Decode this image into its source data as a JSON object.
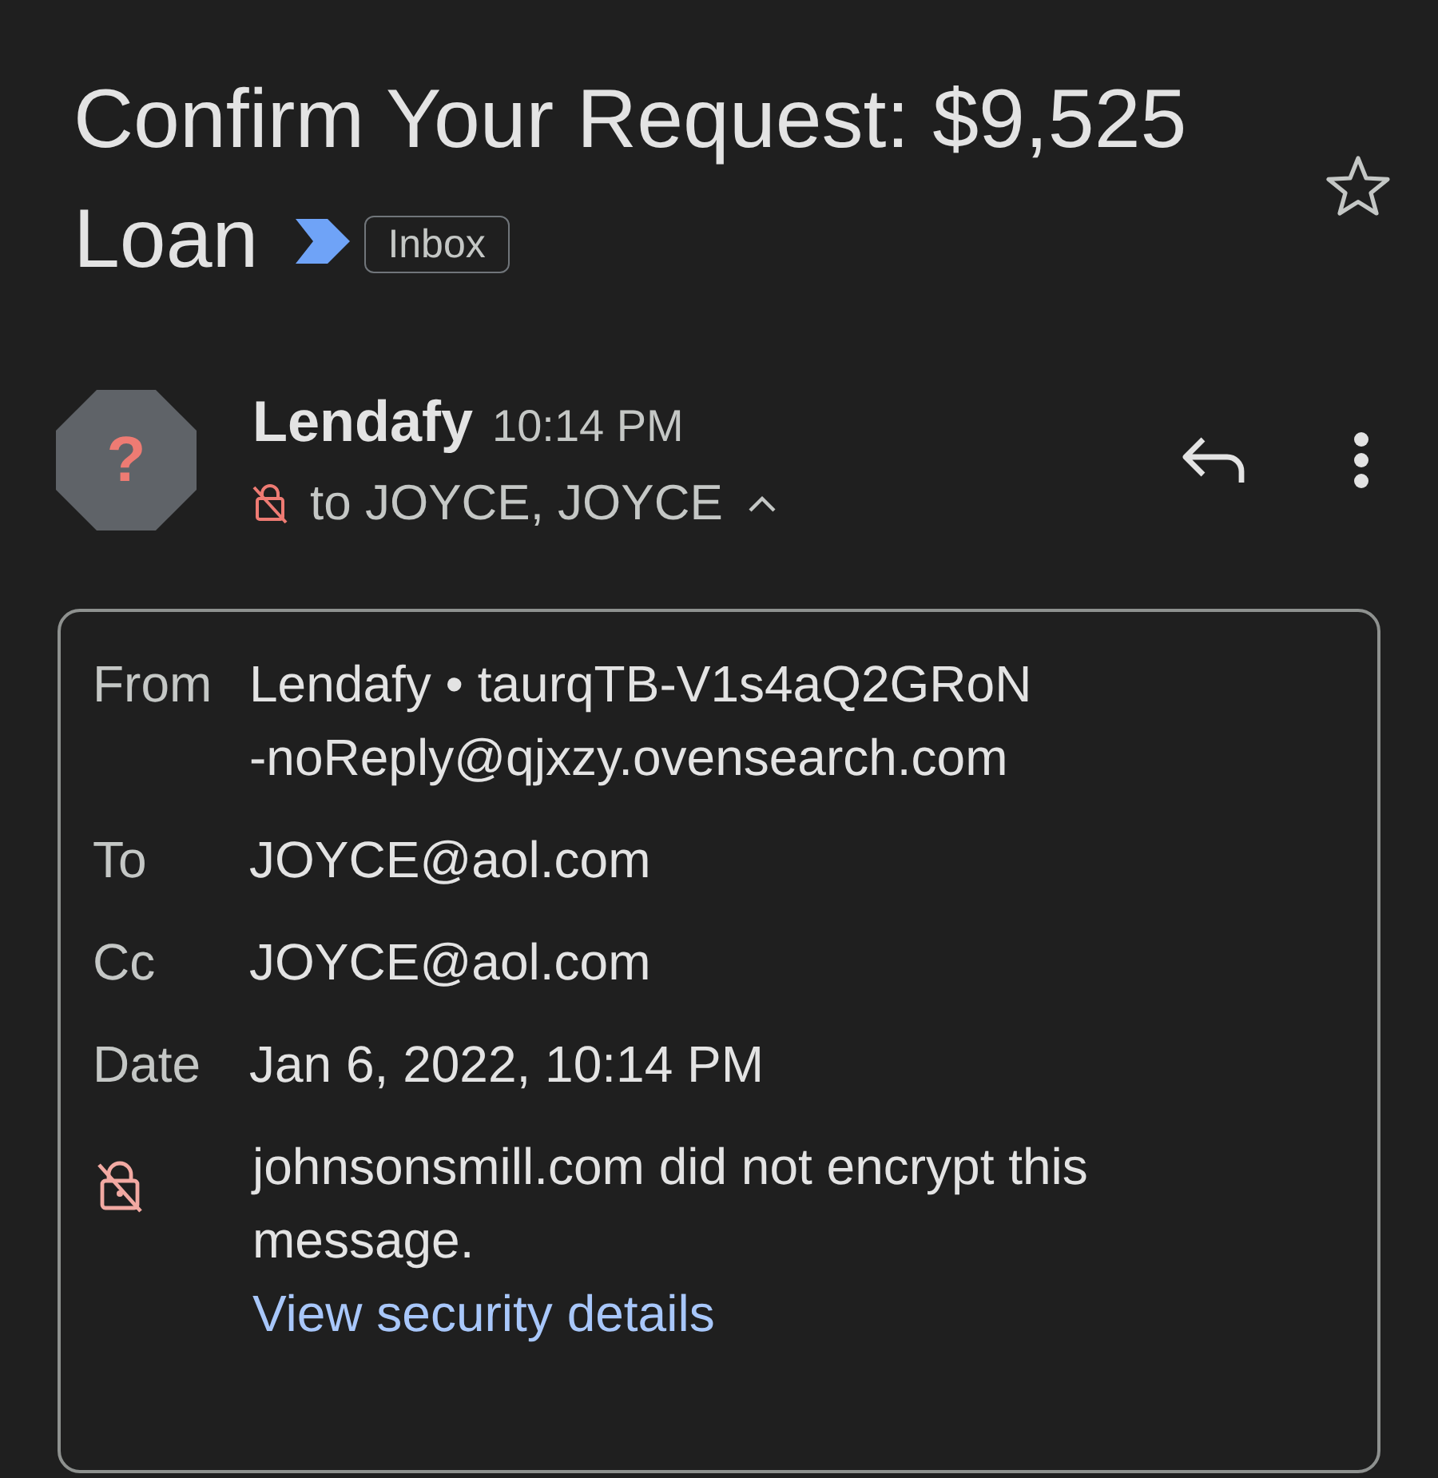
{
  "subject": {
    "title_lines": [
      "Confirm Your Request: $9,525",
      "Loan"
    ],
    "important": true,
    "label": "Inbox",
    "starred": false
  },
  "sender": {
    "avatar": "?",
    "name": "Lendafy",
    "time": "10:14 PM",
    "recipients": "to JOYCE, JOYCE",
    "details_expanded": true
  },
  "details": {
    "from": {
      "label": "From",
      "value": "Lendafy • taurqTB-V1s4aQ2GRoN\n-noReply@qjxzy.ovensearch.com"
    },
    "rows": [
      {
        "label": "To",
        "value": "JOYCE@aol.com"
      },
      {
        "label": "Cc",
        "value": "JOYCE@aol.com"
      },
      {
        "label": "Date",
        "value": "Jan 6, 2022, 10:14 PM"
      }
    ],
    "security": {
      "encrypted": false,
      "message": "johnsonsmill.com did not encrypt this message.",
      "link": "View security details"
    }
  }
}
